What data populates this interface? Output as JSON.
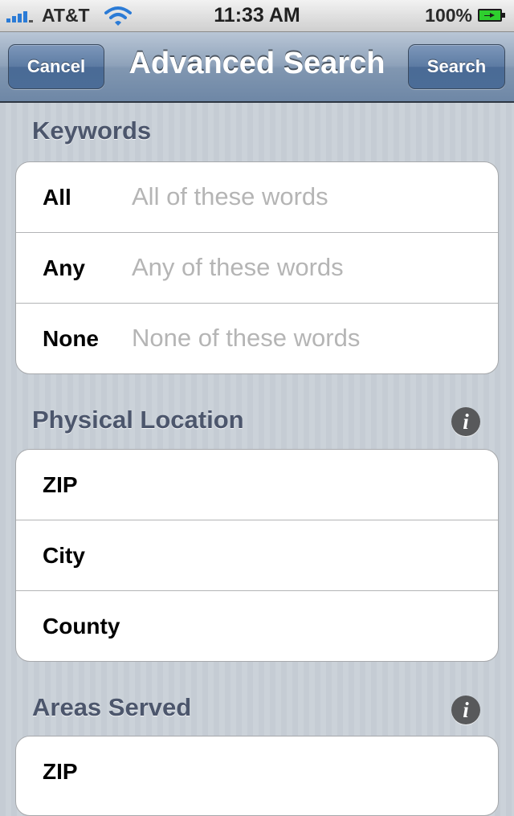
{
  "status_bar": {
    "carrier": "AT&T",
    "time": "11:33 AM",
    "battery": "100%",
    "icons": [
      "signal-icon",
      "wifi-icon",
      "battery-charging-icon"
    ]
  },
  "nav": {
    "cancel_label": "Cancel",
    "title": "Advanced Search",
    "search_label": "Search",
    "accent": "#6e87a6"
  },
  "sections": {
    "keywords": {
      "header": "Keywords",
      "rows": [
        {
          "label": "All",
          "placeholder": "All of these words",
          "value": ""
        },
        {
          "label": "Any",
          "placeholder": "Any of these words",
          "value": ""
        },
        {
          "label": "None",
          "placeholder": "None of these words",
          "value": ""
        }
      ]
    },
    "physical_location": {
      "header": "Physical Location",
      "info_icon": "info-icon",
      "rows": [
        {
          "label": "ZIP",
          "value": ""
        },
        {
          "label": "City",
          "value": ""
        },
        {
          "label": "County",
          "value": ""
        }
      ]
    },
    "areas_served": {
      "header": "Areas Served",
      "info_icon": "info-icon",
      "rows": [
        {
          "label": "ZIP",
          "value": ""
        }
      ]
    }
  }
}
